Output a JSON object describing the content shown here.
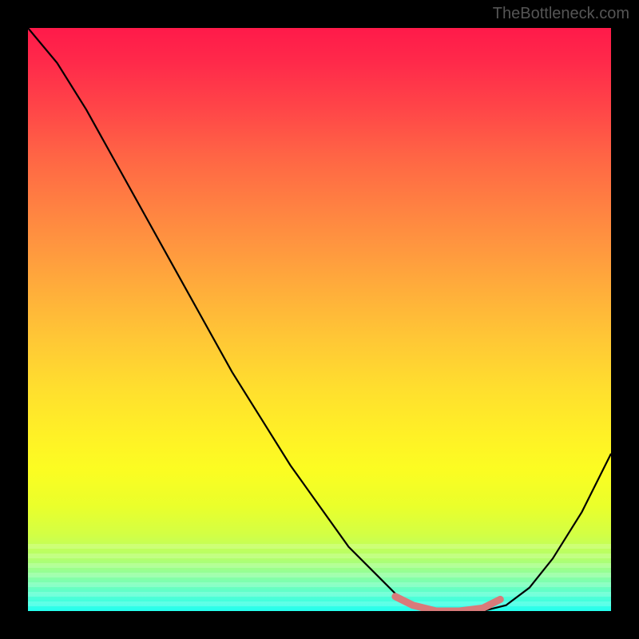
{
  "watermark": "TheBottleneck.com",
  "chart_data": {
    "type": "line",
    "title": "",
    "xlabel": "",
    "ylabel": "",
    "xlim": [
      0,
      100
    ],
    "ylim": [
      0,
      100
    ],
    "grid": false,
    "series": [
      {
        "name": "bottleneck-curve",
        "color": "#000000",
        "x": [
          0,
          5,
          10,
          15,
          20,
          25,
          30,
          35,
          40,
          45,
          50,
          55,
          60,
          63,
          66,
          70,
          74,
          78,
          82,
          86,
          90,
          95,
          100
        ],
        "y": [
          100,
          94,
          86,
          77,
          68,
          59,
          50,
          41,
          33,
          25,
          18,
          11,
          6,
          3,
          1,
          0,
          0,
          0,
          1,
          4,
          9,
          17,
          27
        ]
      },
      {
        "name": "bottom-highlight",
        "color": "#d97a7a",
        "x": [
          63,
          66,
          70,
          74,
          78,
          81
        ],
        "y": [
          2.5,
          1,
          0,
          0,
          0.5,
          2
        ]
      }
    ],
    "gradient": {
      "top_color": "#ff1a4a",
      "mid_color": "#ffdf2e",
      "bottom_color": "#24ffef"
    }
  }
}
